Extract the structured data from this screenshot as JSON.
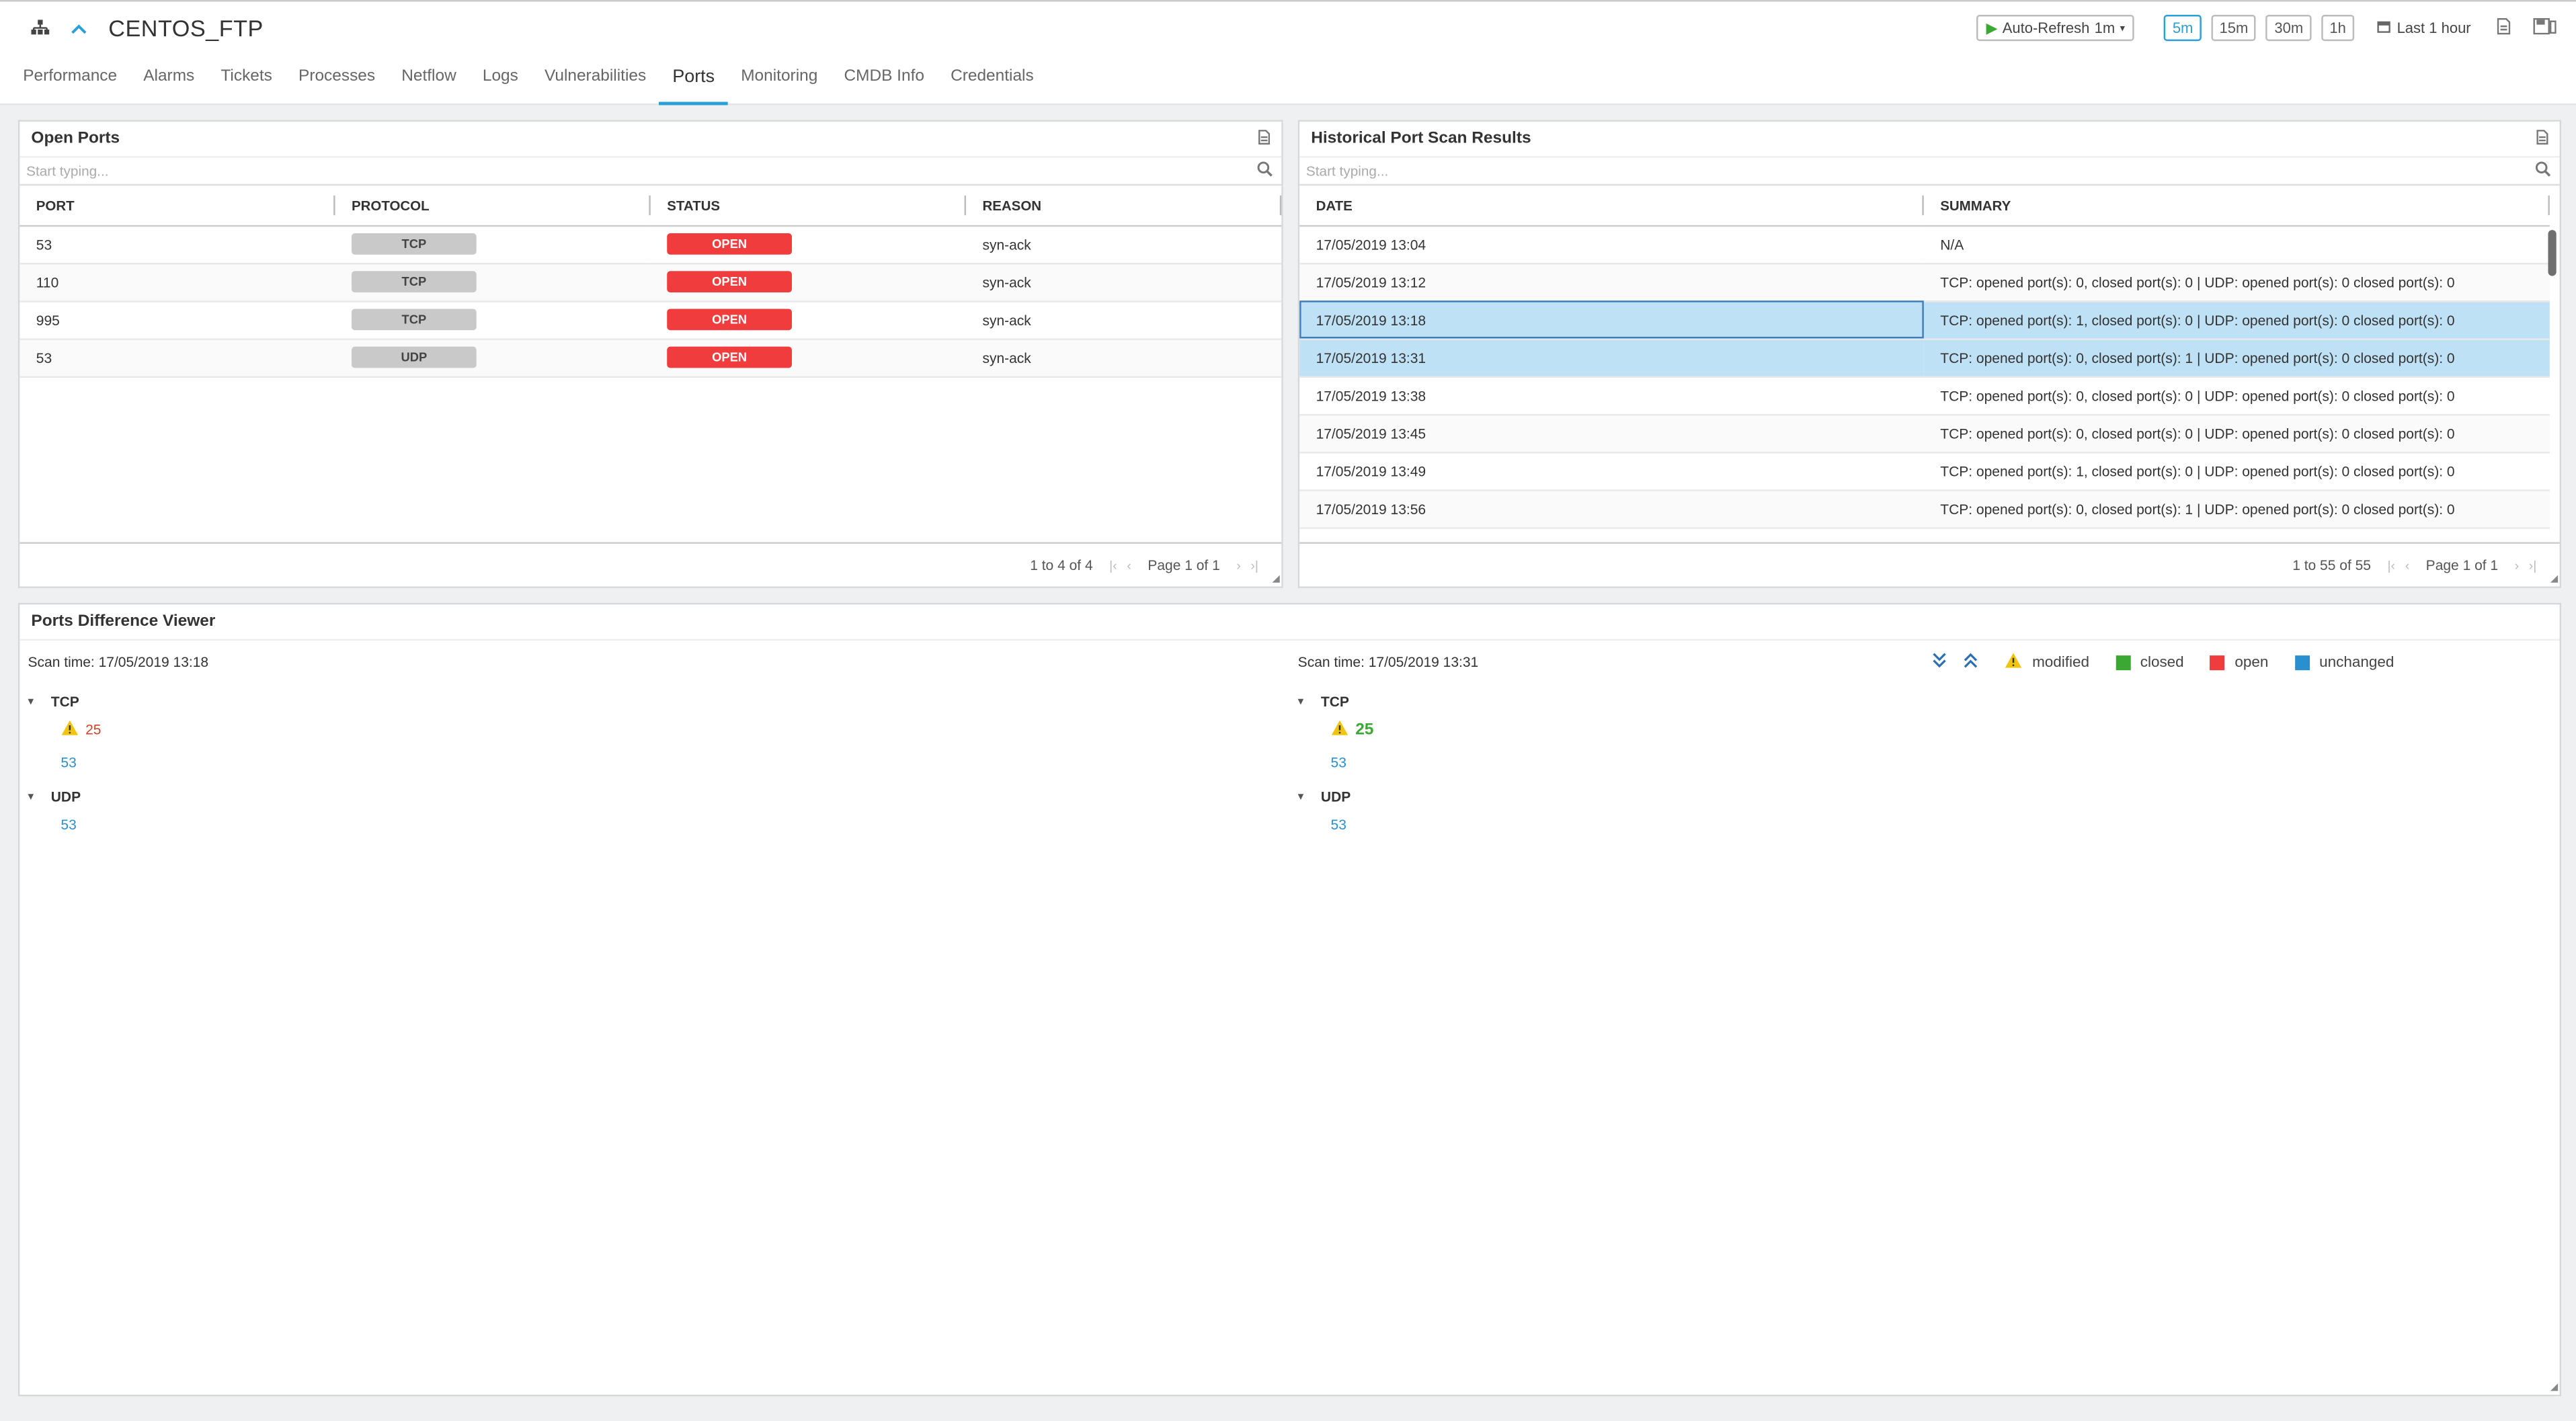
{
  "header": {
    "title": "CENTOS_FTP",
    "auto_refresh": "Auto-Refresh",
    "auto_refresh_interval": "1m",
    "ranges": [
      "5m",
      "15m",
      "30m",
      "1h"
    ],
    "last_range": "Last 1 hour"
  },
  "tabs": [
    "Performance",
    "Alarms",
    "Tickets",
    "Processes",
    "Netflow",
    "Logs",
    "Vulnerabilities",
    "Ports",
    "Monitoring",
    "CMDB Info",
    "Credentials"
  ],
  "active_tab": "Ports",
  "open_ports": {
    "title": "Open Ports",
    "search_placeholder": "Start typing...",
    "columns": [
      "PORT",
      "PROTOCOL",
      "STATUS",
      "REASON"
    ],
    "rows": [
      {
        "port": "53",
        "protocol": "TCP",
        "status": "OPEN",
        "reason": "syn-ack"
      },
      {
        "port": "110",
        "protocol": "TCP",
        "status": "OPEN",
        "reason": "syn-ack"
      },
      {
        "port": "995",
        "protocol": "TCP",
        "status": "OPEN",
        "reason": "syn-ack"
      },
      {
        "port": "53",
        "protocol": "UDP",
        "status": "OPEN",
        "reason": "syn-ack"
      }
    ],
    "count": "1 to 4 of 4",
    "page": "Page 1 of 1"
  },
  "history": {
    "title": "Historical Port Scan Results",
    "search_placeholder": "Start typing...",
    "columns": [
      "DATE",
      "SUMMARY"
    ],
    "rows": [
      {
        "date": "17/05/2019 13:04",
        "summary": "N/A"
      },
      {
        "date": "17/05/2019 13:12",
        "summary": "TCP: opened port(s): 0, closed port(s): 0 | UDP: opened port(s): 0 closed port(s): 0"
      },
      {
        "date": "17/05/2019 13:18",
        "summary": "TCP: opened port(s): 1, closed port(s): 0 | UDP: opened port(s): 0 closed port(s): 0"
      },
      {
        "date": "17/05/2019 13:31",
        "summary": "TCP: opened port(s): 0, closed port(s): 1 | UDP: opened port(s): 0 closed port(s): 0"
      },
      {
        "date": "17/05/2019 13:38",
        "summary": "TCP: opened port(s): 0, closed port(s): 0 | UDP: opened port(s): 0 closed port(s): 0"
      },
      {
        "date": "17/05/2019 13:45",
        "summary": "TCP: opened port(s): 0, closed port(s): 0 | UDP: opened port(s): 0 closed port(s): 0"
      },
      {
        "date": "17/05/2019 13:49",
        "summary": "TCP: opened port(s): 1, closed port(s): 0 | UDP: opened port(s): 0 closed port(s): 0"
      },
      {
        "date": "17/05/2019 13:56",
        "summary": "TCP: opened port(s): 0, closed port(s): 1 | UDP: opened port(s): 0 closed port(s): 0"
      }
    ],
    "count": "1 to 55 of 55",
    "page": "Page 1 of 1"
  },
  "diff": {
    "title": "Ports Difference Viewer",
    "left": {
      "scan_time": "Scan time: 17/05/2019 13:18",
      "tcp_label": "TCP",
      "tcp_modified": "25",
      "tcp_unchanged": "53",
      "udp_label": "UDP",
      "udp_unchanged": "53"
    },
    "right": {
      "scan_time": "Scan time: 17/05/2019 13:31",
      "tcp_label": "TCP",
      "tcp_modified": "25",
      "tcp_unchanged": "53",
      "udp_label": "UDP",
      "udp_unchanged": "53"
    },
    "legend": {
      "modified": "modified",
      "closed": "closed",
      "open": "open",
      "unchanged": "unchanged"
    }
  },
  "colors": {
    "accent": "#2a9fd8",
    "open": "#f03c3c",
    "closed": "#3aa832",
    "unchanged": "#2a8fd0",
    "modified": "#f1c40f"
  }
}
